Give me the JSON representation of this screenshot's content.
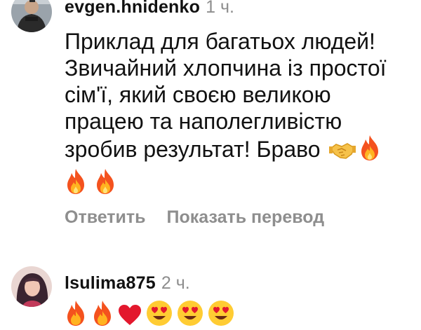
{
  "comments": [
    {
      "username": "evgen.hnidenko",
      "time": "1 ч.",
      "lines": [
        "Приклад для багатьох людей!",
        "Звичайний хлопчина із простої",
        "сім'ї,  який своєю великою",
        "працею та наполегливістю",
        "зробив результат! Браво"
      ],
      "line5_emojis": [
        "handshake-emoji",
        "fire-emoji"
      ],
      "line6_emojis": [
        "fire-emoji",
        "fire-emoji"
      ],
      "actions": {
        "reply_label": "Ответить",
        "translate_label": "Показать перевод"
      }
    },
    {
      "username": "lsulima875",
      "time": "2 ч.",
      "emojis": [
        "fire-emoji",
        "fire-emoji",
        "red-heart-emoji",
        "heart-eyes-emoji",
        "heart-eyes-emoji",
        "heart-eyes-emoji"
      ]
    }
  ],
  "colors": {
    "text": "#111111",
    "muted": "#8e8e8e"
  }
}
